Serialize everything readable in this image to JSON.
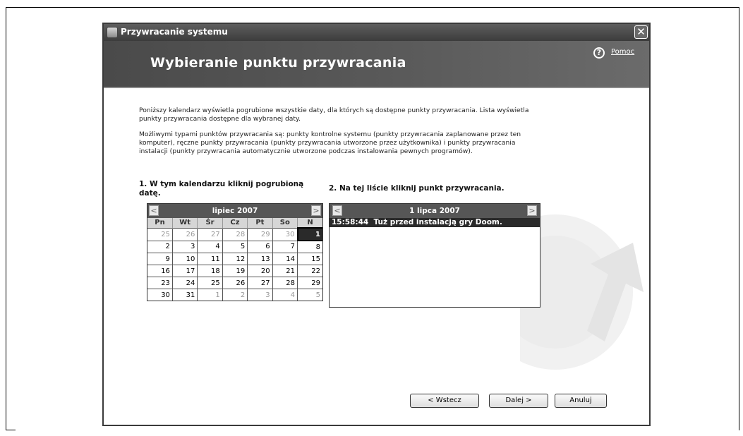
{
  "window": {
    "title": "Przywracanie systemu",
    "close_glyph": "✕"
  },
  "header": {
    "title": "Wybieranie punktu przywracania",
    "help_label": "Pomoc",
    "help_glyph": "?"
  },
  "description": {
    "p1": "Poniższy kalendarz wyświetla pogrubione wszystkie daty, dla których są dostępne punkty przywracania. Lista wyświetla punkty przywracania dostępne dla wybranej daty.",
    "p2": "Możliwymi typami punktów przywracania są: punkty kontrolne systemu (punkty przywracania zaplanowane przez ten komputer), ręczne punkty przywracania (punkty przywracania utworzone przez użytkownika) i punkty przywracania instalacji (punkty przywracania automatycznie utworzone podczas instalowania pewnych programów)."
  },
  "step1": {
    "label": "1. W tym kalendarzu kliknij pogrubioną datę."
  },
  "step2": {
    "label": "2. Na tej liście kliknij punkt przywracania."
  },
  "calendar": {
    "month_label": "lipiec 2007",
    "prev_glyph": "<",
    "next_glyph": ">",
    "weekdays": [
      "Pn",
      "Wt",
      "Śr",
      "Cz",
      "Pt",
      "So",
      "N"
    ],
    "weeks": [
      [
        "25",
        "26",
        "27",
        "28",
        "29",
        "30",
        "1"
      ],
      [
        "2",
        "3",
        "4",
        "5",
        "6",
        "7",
        "8"
      ],
      [
        "9",
        "10",
        "11",
        "12",
        "13",
        "14",
        "15"
      ],
      [
        "16",
        "17",
        "18",
        "19",
        "20",
        "21",
        "22"
      ],
      [
        "23",
        "24",
        "25",
        "26",
        "27",
        "28",
        "29"
      ],
      [
        "30",
        "31",
        "1",
        "2",
        "3",
        "4",
        "5"
      ]
    ],
    "selected_day": "1"
  },
  "restore_list": {
    "date_label": "1 lipca 2007",
    "prev_glyph": "<",
    "next_glyph": ">",
    "items": [
      {
        "time": "15:58:44",
        "description": "Tuż przed instalacją gry Doom.",
        "selected": true
      }
    ]
  },
  "buttons": {
    "back": "< Wstecz",
    "next": "Dalej >",
    "cancel": "Anuluj"
  },
  "icons": {
    "app": "system-restore-icon",
    "help": "help-circle-icon",
    "watermark": "restore-clock-arrow-icon"
  },
  "colors": {
    "titlebar": "#4a4a4a",
    "header": "#555555",
    "selection": "#2a2a2a"
  }
}
